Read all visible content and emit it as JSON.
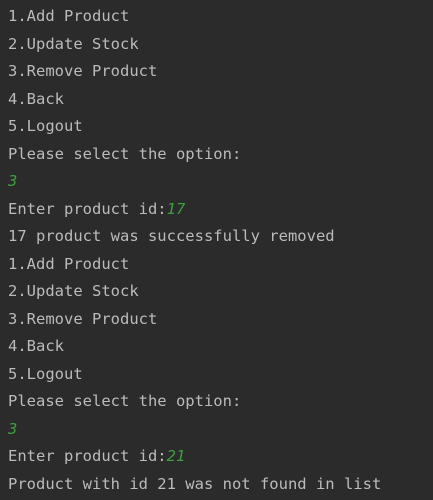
{
  "console": {
    "lines": [
      {
        "text": "1.Add Product"
      },
      {
        "text": "2.Update Stock"
      },
      {
        "text": "3.Remove Product"
      },
      {
        "text": "4.Back"
      },
      {
        "text": "5.Logout"
      },
      {
        "text": "Please select the option:"
      },
      {
        "text": "",
        "input": "3"
      },
      {
        "text": "Enter product id:",
        "input": "17"
      },
      {
        "text": "17 product was successfully removed"
      },
      {
        "text": "1.Add Product"
      },
      {
        "text": "2.Update Stock"
      },
      {
        "text": "3.Remove Product"
      },
      {
        "text": "4.Back"
      },
      {
        "text": "5.Logout"
      },
      {
        "text": "Please select the option:"
      },
      {
        "text": "",
        "input": "3"
      },
      {
        "text": "Enter product id:",
        "input": "21"
      },
      {
        "text": "Product with id 21 was not found in list"
      }
    ]
  },
  "colors": {
    "background": "#2b2b2b",
    "output_text": "#bbbbbb",
    "user_input": "#3e9e3e"
  }
}
